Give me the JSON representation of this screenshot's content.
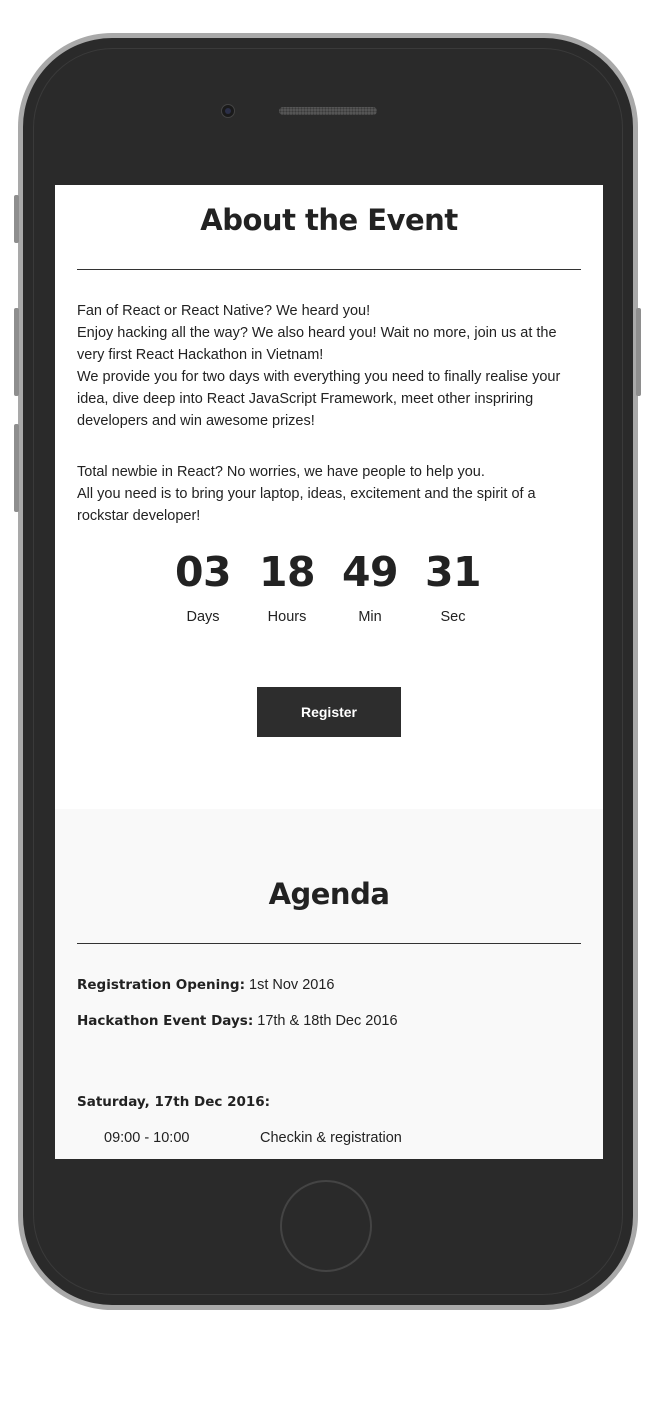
{
  "about": {
    "title": "About the Event",
    "intro": [
      "Fan of React or React Native? We heard you!",
      "Enjoy hacking all the way? We also heard you! Wait no more, join us at the very first React Hackathon in Vietnam!",
      "We provide you for two days with everything you need to finally realise your idea, dive deep into React JavaScript Framework, meet other inspriring developers and win awesome prizes!"
    ],
    "outro": [
      "Total newbie in React? No worries, we have people to help you.",
      "All you need is to bring your laptop, ideas, excitement and the spirit of a rockstar developer!"
    ],
    "countdown": [
      {
        "value": "03",
        "label": "Days"
      },
      {
        "value": "18",
        "label": "Hours"
      },
      {
        "value": "49",
        "label": "Min"
      },
      {
        "value": "31",
        "label": "Sec"
      }
    ],
    "register_label": "Register"
  },
  "agenda": {
    "title": "Agenda",
    "registration_label": "Registration Opening:",
    "registration_value": "1st Nov 2016",
    "event_days_label": "Hackathon Event Days:",
    "event_days_value": "17th & 18th Dec 2016",
    "day_heading": "Saturday, 17th Dec 2016:",
    "schedule": [
      {
        "time": "09:00 - 10:00",
        "activity": "Checkin & registration"
      }
    ]
  },
  "colors": {
    "text": "#222222",
    "button_bg": "#2d2d2d",
    "button_text": "#ffffff",
    "agenda_bg": "#f9f9f9",
    "phone_body": "#2a2a2a",
    "phone_rim": "#a9a9a9"
  }
}
